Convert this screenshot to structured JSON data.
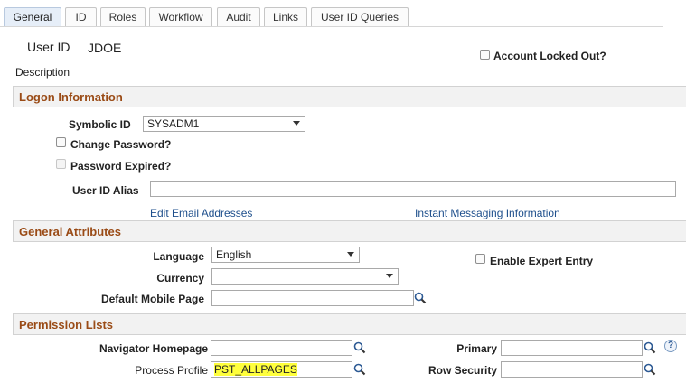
{
  "tabs": [
    {
      "label": "General",
      "active": true
    },
    {
      "label": "ID"
    },
    {
      "label": "Roles"
    },
    {
      "label": "Workflow"
    },
    {
      "label": "Audit"
    },
    {
      "label": "Links"
    },
    {
      "label": "User ID Queries"
    }
  ],
  "header": {
    "user_id_label": "User ID",
    "user_id_value": "JDOE",
    "description_label": "Description",
    "account_locked_label": "Account Locked Out?"
  },
  "logon": {
    "title": "Logon Information",
    "symbolic_id_label": "Symbolic ID",
    "symbolic_id_value": "SYSADM1",
    "change_password_label": "Change Password?",
    "password_expired_label": "Password Expired?",
    "user_id_alias_label": "User ID Alias",
    "user_id_alias_value": "",
    "edit_email_link": "Edit Email Addresses",
    "instant_messaging_link": "Instant Messaging Information"
  },
  "general_attributes": {
    "title": "General Attributes",
    "language_label": "Language",
    "language_value": "English",
    "enable_expert_label": "Enable Expert Entry",
    "currency_label": "Currency",
    "currency_value": "",
    "default_mobile_label": "Default Mobile Page",
    "default_mobile_value": ""
  },
  "permission_lists": {
    "title": "Permission Lists",
    "navigator_homepage_label": "Navigator Homepage",
    "navigator_homepage_value": "",
    "primary_label": "Primary",
    "primary_value": "",
    "process_profile_label": "Process Profile",
    "process_profile_value": "PST_ALLPAGES",
    "row_security_label": "Row Security",
    "row_security_value": "",
    "help_glyph": "?"
  },
  "colors": {
    "section_title": "#9a4b16",
    "link": "#1e4f8c",
    "highlight": "#ffff3c"
  }
}
